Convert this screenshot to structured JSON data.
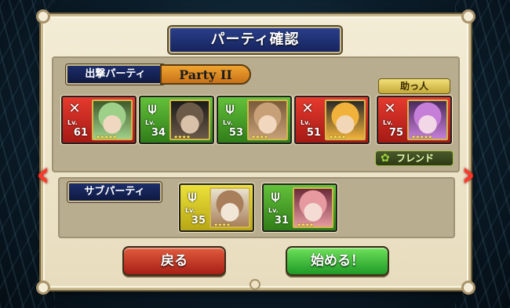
{
  "title": "パーティ確認",
  "main_party": {
    "label": "出撃パーティ",
    "name": "Party II",
    "members": [
      {
        "type": "red",
        "icon": "crossed-swords-icon",
        "level": "61",
        "stars": "★★★★★",
        "portrait_colors": [
          "#9fd08a",
          "#f0d8c0",
          "#3f5a2a"
        ]
      },
      {
        "type": "green",
        "icon": "archer-icon",
        "level": "34",
        "stars": "★★★★",
        "portrait_colors": [
          "#6b5a48",
          "#d9c0a8",
          "#1a1a1a"
        ]
      },
      {
        "type": "green",
        "icon": "archer-icon",
        "level": "53",
        "stars": "★★★★",
        "portrait_colors": [
          "#c7a077",
          "#f1d7be",
          "#7a5a3a"
        ]
      },
      {
        "type": "red",
        "icon": "crossed-swords-icon",
        "level": "51",
        "stars": "★★★★",
        "portrait_colors": [
          "#f0b23a",
          "#f2d6b8",
          "#2a2a2a"
        ]
      }
    ]
  },
  "helper": {
    "label": "助っ人",
    "member": {
      "type": "red",
      "icon": "crossed-swords-icon",
      "level": "75",
      "stars": "★★★★★",
      "portrait_colors": [
        "#c67fd9",
        "#f2d8e6",
        "#4a2a5a"
      ]
    },
    "friend_label": "フレンド"
  },
  "sub_party": {
    "label": "サブパーティ",
    "members": [
      {
        "type": "yellow",
        "icon": "bow-icon",
        "level": "35",
        "stars": "★★★★",
        "portrait_colors": [
          "#a87f5a",
          "#f2e6d6",
          "#e9e2d0"
        ]
      },
      {
        "type": "green",
        "icon": "archer-icon",
        "level": "31",
        "stars": "★★★★",
        "portrait_colors": [
          "#e69aa0",
          "#f4dcd4",
          "#6b2a3a"
        ]
      }
    ]
  },
  "lv_tag": "Lv.",
  "buttons": {
    "back": "戻る",
    "start": "始める！"
  },
  "arrows": {
    "left": "‹",
    "right": "›"
  }
}
